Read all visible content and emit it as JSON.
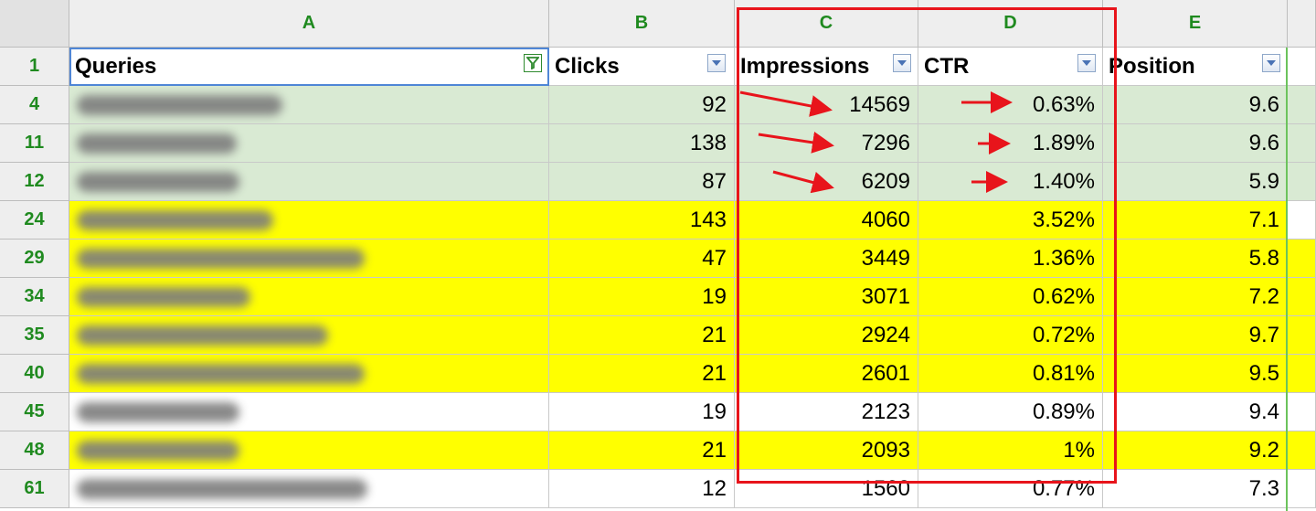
{
  "columns": [
    "A",
    "B",
    "C",
    "D",
    "E"
  ],
  "headers": {
    "row_label": "1",
    "queries": "Queries",
    "clicks": "Clicks",
    "impressions": "Impressions",
    "ctr": "CTR",
    "position": "Position"
  },
  "icons": {
    "filter_active": "funnel-filter-icon",
    "dropdown": "chevron-down-icon"
  },
  "colors": {
    "green_highlight": "#d9ead3",
    "yellow_highlight": "#ffff00",
    "annotation_red": "#e8141b"
  },
  "rows": [
    {
      "row": "4",
      "clicks": "92",
      "impressions": "14569",
      "ctr": "0.63%",
      "position": "9.6",
      "highlight": "green",
      "arrows": true
    },
    {
      "row": "11",
      "clicks": "138",
      "impressions": "7296",
      "ctr": "1.89%",
      "position": "9.6",
      "highlight": "green",
      "arrows": true
    },
    {
      "row": "12",
      "clicks": "87",
      "impressions": "6209",
      "ctr": "1.40%",
      "position": "5.9",
      "highlight": "green",
      "arrows": true
    },
    {
      "row": "24",
      "clicks": "143",
      "impressions": "4060",
      "ctr": "3.52%",
      "position": "7.1",
      "highlight": "yellow",
      "arrows": false
    },
    {
      "row": "29",
      "clicks": "47",
      "impressions": "3449",
      "ctr": "1.36%",
      "position": "5.8",
      "highlight": "yellow",
      "arrows": false
    },
    {
      "row": "34",
      "clicks": "19",
      "impressions": "3071",
      "ctr": "0.62%",
      "position": "7.2",
      "highlight": "yellow",
      "arrows": false
    },
    {
      "row": "35",
      "clicks": "21",
      "impressions": "2924",
      "ctr": "0.72%",
      "position": "9.7",
      "highlight": "yellow",
      "arrows": false
    },
    {
      "row": "40",
      "clicks": "21",
      "impressions": "2601",
      "ctr": "0.81%",
      "position": "9.5",
      "highlight": "yellow",
      "arrows": false
    },
    {
      "row": "45",
      "clicks": "19",
      "impressions": "2123",
      "ctr": "0.89%",
      "position": "9.4",
      "highlight": "none",
      "arrows": false
    },
    {
      "row": "48",
      "clicks": "21",
      "impressions": "2093",
      "ctr": "1%",
      "position": "9.2",
      "highlight": "yellow",
      "arrows": false
    },
    {
      "row": "61",
      "clicks": "12",
      "impressions": "1560",
      "ctr": "0.77%",
      "position": "7.3",
      "highlight": "none",
      "arrows": false
    }
  ]
}
